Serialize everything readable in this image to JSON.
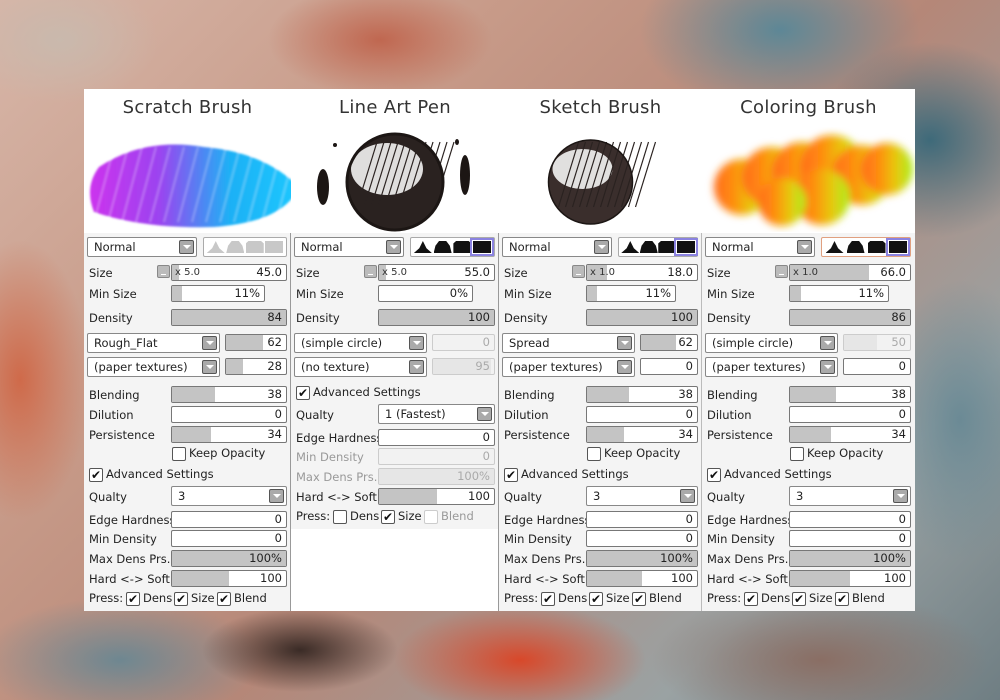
{
  "brushes": [
    {
      "title": "Scratch Brush",
      "preview": "gradient-stroke",
      "preview_colors": [
        "#cc33ee",
        "#9b44f0",
        "#1fb0f5",
        "#1ec8ff"
      ],
      "blend_mode": "Normal",
      "shapes_enabled": false,
      "selected_shape": null,
      "size_label": "Size",
      "size_multiplier": "x 5.0",
      "size_value": "45.0",
      "size_fill": 0.06,
      "min_size_label": "Min Size",
      "min_size_value": "11%",
      "min_size_fill": 0.11,
      "density_label": "Density",
      "density_value": "84",
      "density_fill": 1.0,
      "shape_select": "Rough_Flat",
      "shape_value": "62",
      "shape_fill": 0.62,
      "shape_disabled": false,
      "texture_select": "(paper textures)",
      "texture_value": "28",
      "texture_fill": 0.28,
      "texture_disabled": false,
      "blending_label": "Blending",
      "blending_value": "38",
      "blending_fill": 0.38,
      "dilution_label": "Dilution",
      "dilution_value": "0",
      "dilution_fill": 0,
      "persistence_label": "Persistence",
      "persistence_value": "34",
      "persistence_fill": 0.34,
      "keep_opacity_label": "Keep Opacity",
      "keep_opacity": false,
      "advanced_label": "Advanced Settings",
      "advanced": true,
      "quality_label": "Qualty",
      "quality_value": "3",
      "edge_label": "Edge Hardness",
      "edge_value": "0",
      "edge_fill": 0,
      "min_density_label": "Min Density",
      "min_density_value": "0",
      "min_density_fill": 0,
      "min_density_disabled": false,
      "max_dens_label": "Max Dens Prs.",
      "max_dens_value": "100%",
      "max_dens_fill": 1.0,
      "max_dens_disabled": false,
      "hard_soft_label": "Hard <-> Soft",
      "hard_soft_value": "100",
      "hard_soft_fill": 0.5,
      "press_label": "Press:",
      "press_dens_label": "Dens",
      "press_dens": true,
      "press_size_label": "Size",
      "press_size": true,
      "press_blend_label": "Blend",
      "press_blend": true,
      "press_blend_disabled": false
    },
    {
      "title": "Line Art Pen",
      "preview": "inked-sphere",
      "blend_mode": "Normal",
      "shapes_enabled": true,
      "selected_shape": 3,
      "size_label": "Size",
      "size_multiplier": "x 5.0",
      "size_value": "55.0",
      "size_fill": 0.06,
      "min_size_label": "Min Size",
      "min_size_value": "0%",
      "min_size_fill": 0,
      "density_label": "Density",
      "density_value": "100",
      "density_fill": 1.0,
      "shape_select": "(simple circle)",
      "shape_value": "0",
      "shape_fill": 0,
      "shape_disabled": true,
      "texture_select": "(no texture)",
      "texture_value": "95",
      "texture_fill": 0.95,
      "texture_disabled": true,
      "advanced_label": "Advanced Settings",
      "advanced": true,
      "quality_label": "Qualty",
      "quality_value": "1 (Fastest)",
      "edge_label": "Edge Hardness",
      "edge_value": "0",
      "edge_fill": 0,
      "min_density_label": "Min Density",
      "min_density_value": "0",
      "min_density_fill": 0,
      "min_density_disabled": true,
      "max_dens_label": "Max Dens Prs.",
      "max_dens_value": "100%",
      "max_dens_fill": 1.0,
      "max_dens_disabled": true,
      "hard_soft_label": "Hard <-> Soft",
      "hard_soft_value": "100",
      "hard_soft_fill": 0.5,
      "press_label": "Press:",
      "press_dens_label": "Dens",
      "press_dens": false,
      "press_size_label": "Size",
      "press_size": true,
      "press_blend_label": "Blend",
      "press_blend": false,
      "press_blend_disabled": true
    },
    {
      "title": "Sketch Brush",
      "preview": "sketched-sphere",
      "blend_mode": "Normal",
      "shapes_enabled": true,
      "selected_shape": 3,
      "size_label": "Size",
      "size_multiplier": "x 1.0",
      "size_value": "18.0",
      "size_fill": 0.18,
      "min_size_label": "Min Size",
      "min_size_value": "11%",
      "min_size_fill": 0.11,
      "density_label": "Density",
      "density_value": "100",
      "density_fill": 1.0,
      "shape_select": "Spread",
      "shape_value": "62",
      "shape_fill": 0.62,
      "shape_disabled": false,
      "texture_select": "(paper textures)",
      "texture_value": "0",
      "texture_fill": 0,
      "texture_disabled": false,
      "blending_label": "Blending",
      "blending_value": "38",
      "blending_fill": 0.38,
      "dilution_label": "Dilution",
      "dilution_value": "0",
      "dilution_fill": 0,
      "persistence_label": "Persistence",
      "persistence_value": "34",
      "persistence_fill": 0.34,
      "keep_opacity_label": "Keep Opacity",
      "keep_opacity": false,
      "advanced_label": "Advanced Settings",
      "advanced": true,
      "quality_label": "Qualty",
      "quality_value": "3",
      "edge_label": "Edge Hardness",
      "edge_value": "0",
      "edge_fill": 0,
      "min_density_label": "Min Density",
      "min_density_value": "0",
      "min_density_fill": 0,
      "min_density_disabled": false,
      "max_dens_label": "Max Dens Prs.",
      "max_dens_value": "100%",
      "max_dens_fill": 1.0,
      "max_dens_disabled": false,
      "hard_soft_label": "Hard <-> Soft",
      "hard_soft_value": "100",
      "hard_soft_fill": 0.5,
      "press_label": "Press:",
      "press_dens_label": "Dens",
      "press_dens": true,
      "press_size_label": "Size",
      "press_size": true,
      "press_blend_label": "Blend",
      "press_blend": true,
      "press_blend_disabled": false
    },
    {
      "title": "Coloring Brush",
      "preview": "soft-gradient-stroke",
      "preview_colors": [
        "#ff6a1a",
        "#ff8c10",
        "#e8c810",
        "#a8f020"
      ],
      "blend_mode": "Normal",
      "shapes_enabled": true,
      "selected_shape": 3,
      "size_label": "Size",
      "size_multiplier": "x 1.0",
      "size_value": "66.0",
      "size_fill": 0.66,
      "min_size_label": "Min Size",
      "min_size_value": "11%",
      "min_size_fill": 0.11,
      "density_label": "Density",
      "density_value": "86",
      "density_fill": 1.0,
      "shape_select": "(simple circle)",
      "shape_value": "50",
      "shape_fill": 0.5,
      "shape_disabled": true,
      "texture_select": "(paper textures)",
      "texture_value": "0",
      "texture_fill": 0,
      "texture_disabled": false,
      "blending_label": "Blending",
      "blending_value": "38",
      "blending_fill": 0.38,
      "dilution_label": "Dilution",
      "dilution_value": "0",
      "dilution_fill": 0,
      "persistence_label": "Persistence",
      "persistence_value": "34",
      "persistence_fill": 0.34,
      "keep_opacity_label": "Keep Opacity",
      "keep_opacity": false,
      "advanced_label": "Advanced Settings",
      "advanced": true,
      "quality_label": "Qualty",
      "quality_value": "3",
      "edge_label": "Edge Hardness",
      "edge_value": "0",
      "edge_fill": 0,
      "min_density_label": "Min Density",
      "min_density_value": "0",
      "min_density_fill": 0,
      "min_density_disabled": false,
      "max_dens_label": "Max Dens Prs.",
      "max_dens_value": "100%",
      "max_dens_fill": 1.0,
      "max_dens_disabled": false,
      "hard_soft_label": "Hard <-> Soft",
      "hard_soft_value": "100",
      "hard_soft_fill": 0.5,
      "press_label": "Press:",
      "press_dens_label": "Dens",
      "press_dens": true,
      "press_size_label": "Size",
      "press_size": true,
      "press_blend_label": "Blend",
      "press_blend": true,
      "press_blend_disabled": false
    }
  ],
  "icons": {
    "dropdown": "chevron-down-icon",
    "check": "✔",
    "shapes": [
      "brush-shape-sharp-icon",
      "brush-shape-round-icon",
      "brush-shape-flat-icon",
      "brush-shape-square-icon"
    ]
  }
}
